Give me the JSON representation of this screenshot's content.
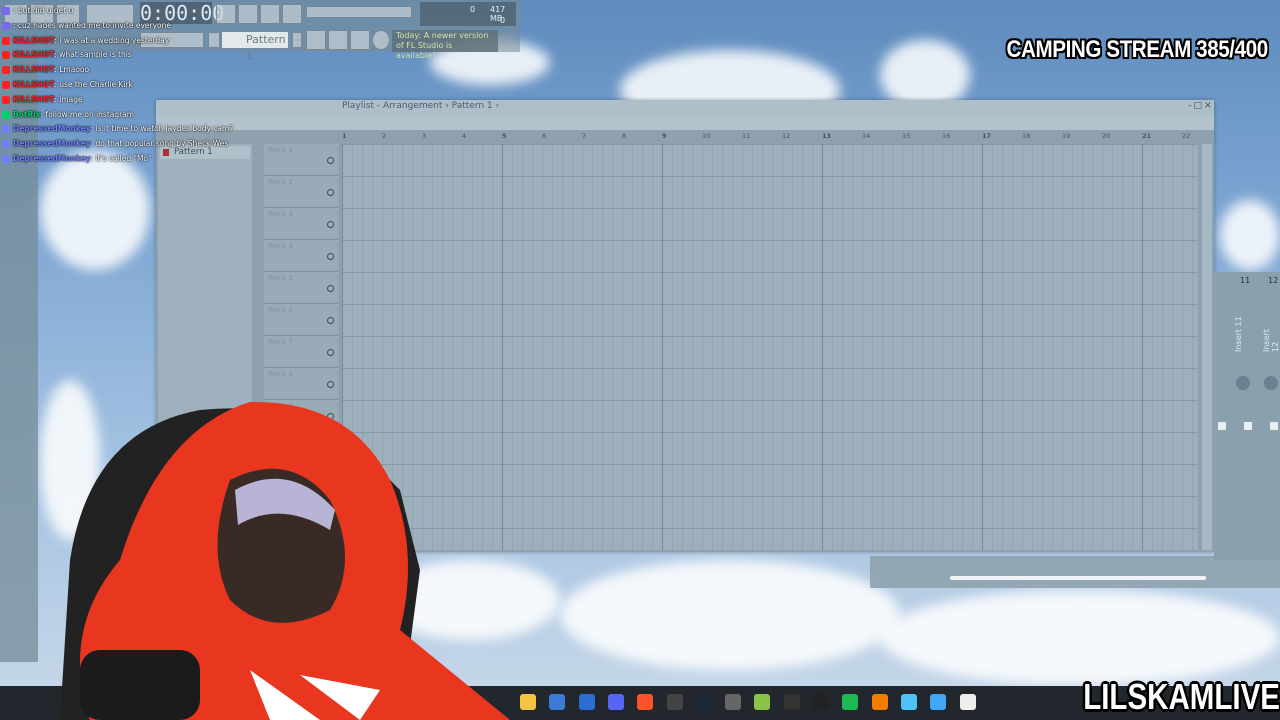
{
  "overlay": {
    "stream_title": "CAMPING STREAM 385/400",
    "streamer_name": "LILSKAMLIVE"
  },
  "fl_toolbar": {
    "time": "0:00:00",
    "pattern_label": "Pattern 1",
    "news_text": "Today: A newer version of FL Studio is available!",
    "memory": "417 MB",
    "cpu": "0",
    "poly": "0"
  },
  "chat": [
    {
      "user": "",
      "message": ": but did u get u",
      "color": "#7b68ee"
    },
    {
      "user": "",
      "message": ": cuz hades wanted me to invite everyone",
      "color": "#7b68ee"
    },
    {
      "user": "KILLSHOT",
      "message": ": i was at a wedding yesterday",
      "color": "#ff2222"
    },
    {
      "user": "KILLSHOT",
      "message": ": what sample is this",
      "color": "#ff2222"
    },
    {
      "user": "KILLSHOT",
      "message": ": Lmaooo",
      "color": "#ff2222"
    },
    {
      "user": "KILLSHOT",
      "message": ": use the Charlie Kirk",
      "color": "#ff2222"
    },
    {
      "user": "KILLSHOT",
      "message": ": image",
      "color": "#ff2222"
    },
    {
      "user": "BotRix",
      "message": ": follow me on instagram",
      "color": "#00d26a"
    },
    {
      "user": "DepressedMonkey",
      "message": ": is it time to watch Jaydes body cam?",
      "color": "#6f7fff"
    },
    {
      "user": "DepressedMonkey",
      "message": ": do that popular song by Sheck Wes",
      "color": "#6f7fff"
    },
    {
      "user": "DepressedMonkey",
      "message": ": it's called \"Mo\"",
      "color": "#6f7fff"
    }
  ],
  "playlist": {
    "title": "Playlist - Arrangement › Pattern 1 ›",
    "pattern_item": "Pattern 1",
    "ruler": [
      "1",
      "2",
      "3",
      "4",
      "5",
      "6",
      "7",
      "8",
      "9",
      "10",
      "11",
      "12",
      "13",
      "14",
      "15",
      "16",
      "17",
      "18",
      "19",
      "20",
      "21",
      "22"
    ],
    "tracks": [
      "Track 1",
      "Track 2",
      "Track 3",
      "Track 4",
      "Track 5",
      "Track 6",
      "Track 7",
      "Track 8",
      "Track 9"
    ]
  },
  "mixer": {
    "channels": [
      "11",
      "12"
    ],
    "inserts": [
      "Insert 11",
      "Insert 12"
    ]
  },
  "taskbar_icons": [
    "file-explorer-icon",
    "store-icon",
    "photoshop-icon",
    "discord-icon",
    "brave-icon",
    "obs-icon",
    "steam-icon",
    "keyboard-icon",
    "bluestacks-icon",
    "4k-icon",
    "capcut-icon",
    "spotify-icon",
    "fl-studio-icon",
    "notepad-icon",
    "photos-icon",
    "document-icon"
  ]
}
